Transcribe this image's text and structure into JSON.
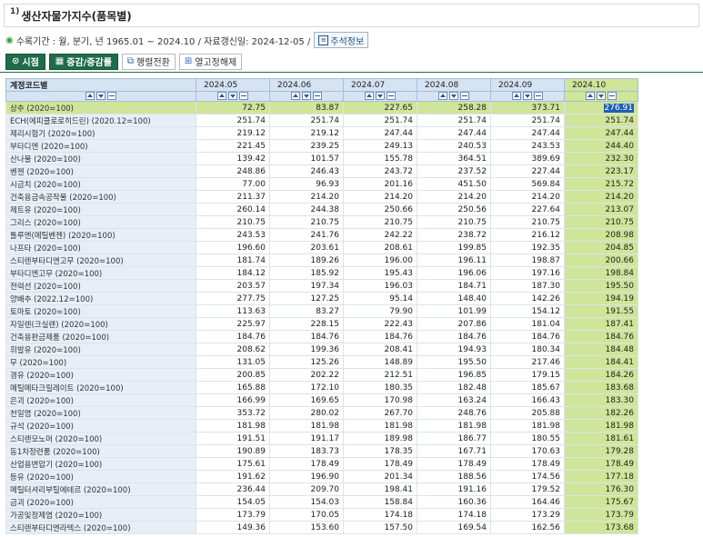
{
  "header": {
    "number": "1)",
    "title": "생산자물가지수(품목별)"
  },
  "info": {
    "text": "수록기간 : 월, 분기, 년 1965.01 ~ 2024.10 / 자료갱신일: 2024-12-05 /",
    "note_label": "주석정보"
  },
  "toolbar": {
    "view_label": "시점",
    "change_label": "증감/증감률",
    "pivot_label": "행렬전환",
    "unfreeze_label": "열고정해제"
  },
  "table": {
    "first_header": "계정코드별",
    "columns": [
      "2024.05",
      "2024.06",
      "2024.07",
      "2024.08",
      "2024.09",
      "2024.10"
    ],
    "rows": [
      {
        "name": "상추 (2020=100)",
        "values": [
          "72.75",
          "83.87",
          "227.65",
          "258.28",
          "373.71",
          "276.91"
        ]
      },
      {
        "name": "ECH(에피클로로히드린) (2020.12=100)",
        "values": [
          "251.74",
          "251.74",
          "251.74",
          "251.74",
          "251.74",
          "251.74"
        ]
      },
      {
        "name": "제리시험기 (2020=100)",
        "values": [
          "219.12",
          "219.12",
          "247.44",
          "247.44",
          "247.44",
          "247.44"
        ]
      },
      {
        "name": "부타디엔 (2020=100)",
        "values": [
          "221.45",
          "239.25",
          "249.13",
          "240.53",
          "243.53",
          "244.40"
        ]
      },
      {
        "name": "산나물 (2020=100)",
        "values": [
          "139.42",
          "101.57",
          "155.78",
          "364.51",
          "389.69",
          "232.30"
        ]
      },
      {
        "name": "벤젠 (2020=100)",
        "values": [
          "248.86",
          "246.43",
          "243.72",
          "237.52",
          "227.44",
          "223.17"
        ]
      },
      {
        "name": "시금치 (2020=100)",
        "values": [
          "77.00",
          "96.93",
          "201.16",
          "451.50",
          "569.84",
          "215.72"
        ]
      },
      {
        "name": "건축용금속공작물 (2020=100)",
        "values": [
          "211.37",
          "214.20",
          "214.20",
          "214.20",
          "214.20",
          "214.20"
        ]
      },
      {
        "name": "제트유 (2020=100)",
        "values": [
          "260.14",
          "244.38",
          "250.66",
          "250.56",
          "227.64",
          "213.07"
        ]
      },
      {
        "name": "그리스 (2020=100)",
        "values": [
          "210.75",
          "210.75",
          "210.75",
          "210.75",
          "210.75",
          "210.75"
        ]
      },
      {
        "name": "톨루엔(메틸벤젠) (2020=100)",
        "values": [
          "243.53",
          "241.76",
          "242.22",
          "238.72",
          "216.12",
          "208.98"
        ]
      },
      {
        "name": "나프타 (2020=100)",
        "values": [
          "196.60",
          "203.61",
          "208.61",
          "199.85",
          "192.35",
          "204.85"
        ]
      },
      {
        "name": "스티렌부타디엔고무 (2020=100)",
        "values": [
          "181.74",
          "189.26",
          "196.00",
          "196.11",
          "198.87",
          "200.66"
        ]
      },
      {
        "name": "부타디엔고무 (2020=100)",
        "values": [
          "184.12",
          "185.92",
          "195.43",
          "196.06",
          "197.16",
          "198.84"
        ]
      },
      {
        "name": "전력선 (2020=100)",
        "values": [
          "203.57",
          "197.34",
          "196.03",
          "184.71",
          "187.30",
          "195.50"
        ]
      },
      {
        "name": "양배추 (2022.12=100)",
        "values": [
          "277.75",
          "127.25",
          "95.14",
          "148.40",
          "142.26",
          "194.19"
        ]
      },
      {
        "name": "토마토 (2020=100)",
        "values": [
          "113.63",
          "83.27",
          "79.90",
          "101.99",
          "154.12",
          "191.55"
        ]
      },
      {
        "name": "자일렌(크실렌) (2020=100)",
        "values": [
          "225.97",
          "228.15",
          "222.43",
          "207.86",
          "181.04",
          "187.41"
        ]
      },
      {
        "name": "건축용판금제품 (2020=100)",
        "values": [
          "184.76",
          "184.76",
          "184.76",
          "184.76",
          "184.76",
          "184.76"
        ]
      },
      {
        "name": "휘발유 (2020=100)",
        "values": [
          "208.62",
          "199.36",
          "208.41",
          "194.93",
          "180.34",
          "184.48"
        ]
      },
      {
        "name": "무 (2020=100)",
        "values": [
          "131.05",
          "125.26",
          "148.89",
          "195.50",
          "217.46",
          "184.41"
        ]
      },
      {
        "name": "경유 (2020=100)",
        "values": [
          "200.85",
          "202.22",
          "212.51",
          "196.85",
          "179.15",
          "184.26"
        ]
      },
      {
        "name": "메틸메타크릴레이트 (2020=100)",
        "values": [
          "165.88",
          "172.10",
          "180.35",
          "182.48",
          "185.67",
          "183.68"
        ]
      },
      {
        "name": "은괴 (2020=100)",
        "values": [
          "166.99",
          "169.65",
          "170.98",
          "163.24",
          "166.43",
          "183.30"
        ]
      },
      {
        "name": "천일염 (2020=100)",
        "values": [
          "353.72",
          "280.02",
          "267.70",
          "248.76",
          "205.88",
          "182.26"
        ]
      },
      {
        "name": "규석 (2020=100)",
        "values": [
          "181.98",
          "181.98",
          "181.98",
          "181.98",
          "181.98",
          "181.98"
        ]
      },
      {
        "name": "스티렌모노머 (2020=100)",
        "values": [
          "191.51",
          "191.17",
          "189.98",
          "186.77",
          "180.55",
          "181.61"
        ]
      },
      {
        "name": "동1차정련품 (2020=100)",
        "values": [
          "190.89",
          "183.73",
          "178.35",
          "167.71",
          "170.63",
          "179.28"
        ]
      },
      {
        "name": "산업용변압기 (2020=100)",
        "values": [
          "175.61",
          "178.49",
          "178.49",
          "178.49",
          "178.49",
          "178.49"
        ]
      },
      {
        "name": "등유 (2020=100)",
        "values": [
          "191.62",
          "196.90",
          "201.34",
          "188.56",
          "174.56",
          "177.18"
        ]
      },
      {
        "name": "메틸터셔리부틸에테르 (2020=100)",
        "values": [
          "236.44",
          "209.70",
          "198.41",
          "191.16",
          "179.52",
          "176.30"
        ]
      },
      {
        "name": "금괴 (2020=100)",
        "values": [
          "154.05",
          "154.03",
          "158.84",
          "160.36",
          "164.46",
          "175.67"
        ]
      },
      {
        "name": "가공및정제염 (2020=100)",
        "values": [
          "173.79",
          "170.05",
          "174.18",
          "174.18",
          "173.29",
          "173.79"
        ]
      },
      {
        "name": "스티렌부타디엔라텍스 (2020=100)",
        "values": [
          "149.36",
          "153.60",
          "157.50",
          "169.54",
          "162.56",
          "173.68"
        ]
      }
    ]
  }
}
